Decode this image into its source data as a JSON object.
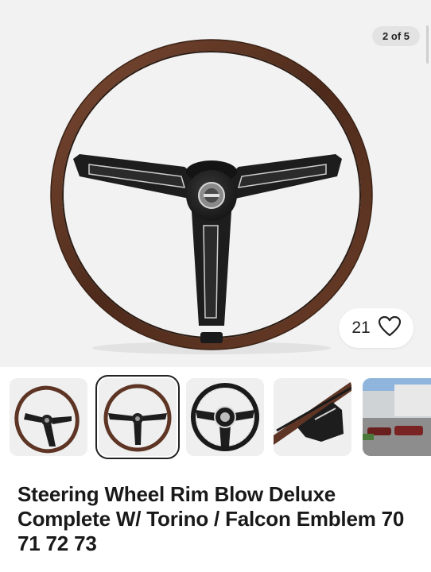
{
  "gallery": {
    "counter": "2 of 5",
    "watchers": "21",
    "thumbnails": [
      {
        "name": "thumb-steering-wheel-angled",
        "selected": false
      },
      {
        "name": "thumb-steering-wheel-front",
        "selected": true
      },
      {
        "name": "thumb-steering-wheel-center-detail",
        "selected": false
      },
      {
        "name": "thumb-steering-wheel-spoke-closeup",
        "selected": false
      },
      {
        "name": "thumb-parking-lot-photo",
        "selected": false
      }
    ]
  },
  "listing": {
    "title": "Steering Wheel Rim Blow Deluxe Complete W/ Torino / Falcon Emblem 70 71 72 73"
  },
  "icons": {
    "watch": "heart-outline-icon"
  },
  "colors": {
    "rim_wood": "#5a3322",
    "spokes": "#1d1d1d",
    "badge_bg": "#e3e3e3",
    "hero_bg": "#f2f2f2"
  }
}
